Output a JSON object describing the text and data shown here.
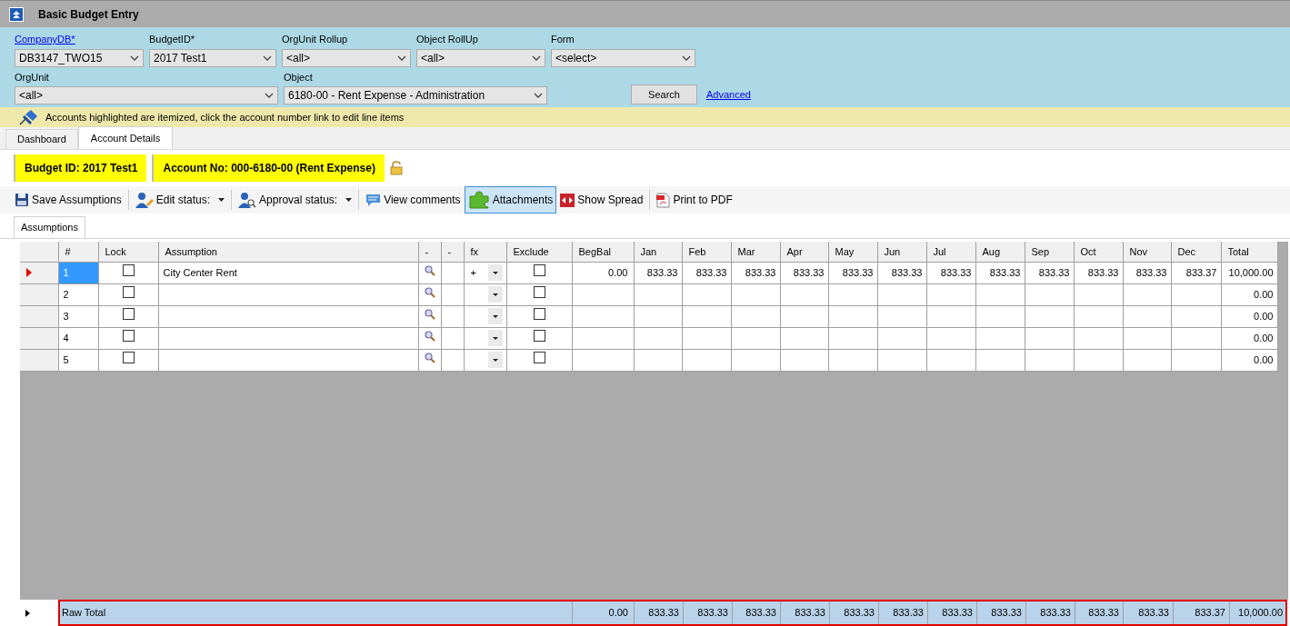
{
  "window": {
    "title": "Basic Budget Entry"
  },
  "filter_rows": [
    [
      {
        "label": "CompanyDB*",
        "label_link": true,
        "value": "DB3147_TWO15"
      },
      {
        "label": "BudgetID*",
        "label_link": false,
        "value": "2017 Test1"
      },
      {
        "label": "OrgUnit Rollup",
        "label_link": false,
        "value": "<all>"
      },
      {
        "label": "Object RollUp",
        "label_link": false,
        "value": "<all>"
      },
      {
        "label": "Form",
        "label_link": false,
        "value": "<select>"
      }
    ],
    [
      {
        "label": "OrgUnit",
        "label_link": false,
        "value": "<all>"
      },
      {
        "label": "Object",
        "label_link": false,
        "value": "6180-00 - Rent Expense - Administration"
      }
    ]
  ],
  "search_button": "Search",
  "advanced_link": "Advanced",
  "info": "Accounts highlighted are itemized, click the account number link to edit line items",
  "tabs": [
    {
      "label": "Dashboard",
      "selected": false
    },
    {
      "label": "Account Details",
      "selected": true
    }
  ],
  "badges": [
    "Budget ID: 2017 Test1",
    "Account No: 000-6180-00 (Rent Expense)"
  ],
  "locked": false,
  "toolbar": [
    {
      "label": "Save Assumptions",
      "kind": "button",
      "selected": false
    },
    {
      "label": "Edit status:",
      "kind": "menu",
      "selected": false
    },
    {
      "label": "Approval status:",
      "kind": "menu",
      "selected": false
    },
    {
      "label": "View comments",
      "kind": "button",
      "selected": false
    },
    {
      "label": "Attachments",
      "kind": "button",
      "selected": true
    },
    {
      "label": "Show Spread",
      "kind": "button",
      "selected": false
    },
    {
      "label": "Print to PDF",
      "kind": "button",
      "selected": false
    }
  ],
  "sub_tabs": [
    {
      "label": "Assumptions",
      "selected": true
    }
  ],
  "grid": {
    "columns": [
      "#",
      "Lock",
      "Assumption",
      "-",
      "-",
      "fx",
      "Exclude",
      "BegBal",
      "Jan",
      "Feb",
      "Mar",
      "Apr",
      "May",
      "Jun",
      "Jul",
      "Aug",
      "Sep",
      "Oct",
      "Nov",
      "Dec",
      "Total"
    ],
    "rows": [
      {
        "number": "1",
        "selected": true,
        "lock": false,
        "assumption": "City Center Rent",
        "fx": "+",
        "exclude": false,
        "begbal": "0.00",
        "months": [
          "833.33",
          "833.33",
          "833.33",
          "833.33",
          "833.33",
          "833.33",
          "833.33",
          "833.33",
          "833.33",
          "833.33",
          "833.33",
          "833.37"
        ],
        "total": "10,000.00"
      },
      {
        "number": "2",
        "selected": false,
        "lock": false,
        "exclude": false,
        "total": "0.00"
      },
      {
        "number": "3",
        "selected": false,
        "lock": false,
        "exclude": false,
        "total": "0.00"
      },
      {
        "number": "4",
        "selected": false,
        "lock": false,
        "exclude": false,
        "total": "0.00"
      },
      {
        "number": "5",
        "selected": false,
        "lock": false,
        "exclude": false,
        "total": "0.00"
      }
    ],
    "total_row": {
      "label": "Raw Total",
      "begbal": "0.00",
      "months": [
        "833.33",
        "833.33",
        "833.33",
        "833.33",
        "833.33",
        "833.33",
        "833.33",
        "833.33",
        "833.33",
        "833.33",
        "833.33",
        "833.37"
      ],
      "total": "10,000.00"
    }
  }
}
